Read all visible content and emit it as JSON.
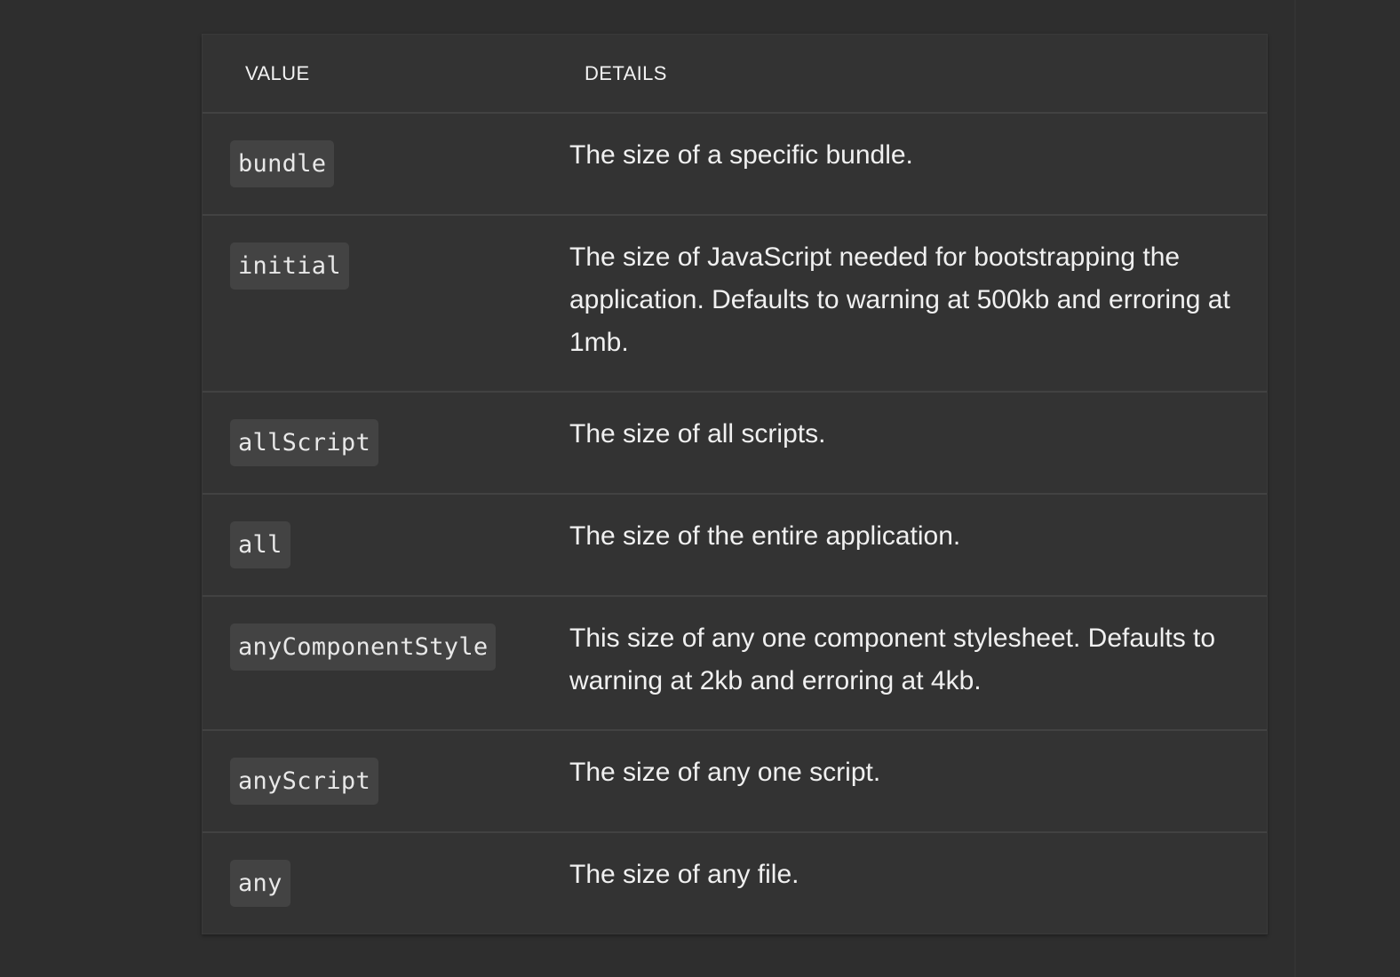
{
  "table": {
    "headers": {
      "value": "VALUE",
      "details": "DETAILS"
    },
    "rows": [
      {
        "value": "bundle",
        "details": "The size of a specific bundle."
      },
      {
        "value": "initial",
        "details": "The size of JavaScript needed for bootstrapping the application. Defaults to warning at 500kb and erroring at 1mb."
      },
      {
        "value": "allScript",
        "details": "The size of all scripts."
      },
      {
        "value": "all",
        "details": "The size of the entire application."
      },
      {
        "value": "anyComponentStyle",
        "details": "This size of any one component stylesheet. Defaults to warning at 2kb and erroring at 4kb."
      },
      {
        "value": "anyScript",
        "details": "The size of any one script."
      },
      {
        "value": "any",
        "details": "The size of any file."
      }
    ]
  },
  "colors": {
    "page_background": "#2e2e2e",
    "table_background": "#333333",
    "code_background": "#434343",
    "divider": "#424242",
    "text": "#f0f0f0"
  }
}
